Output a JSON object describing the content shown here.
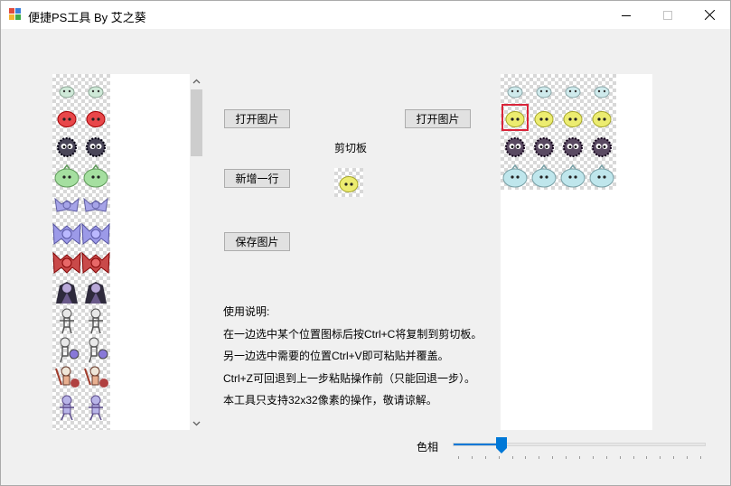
{
  "window": {
    "title": "便捷PS工具 By 艾之葵",
    "controls": {
      "minimize": "minimize",
      "maximize": "maximize",
      "close": "close"
    }
  },
  "left_panel": {
    "sprites": [
      {
        "color": "#cfe9d8",
        "kind": "slime-small"
      },
      {
        "color": "#e8474a",
        "kind": "slime"
      },
      {
        "color": "#4a4658",
        "kind": "fuzz"
      },
      {
        "color": "#a5dfa0",
        "kind": "slime-big"
      },
      {
        "color": "#a6a4e8",
        "kind": "bat-small"
      },
      {
        "color": "#9c9ae8",
        "kind": "bat"
      },
      {
        "color": "#c94a4a",
        "kind": "bat"
      },
      {
        "color": "#2e2a3c",
        "kind": "vampire"
      },
      {
        "color": "#e8e8e8",
        "kind": "skeleton"
      },
      {
        "color": "#e8e8e8",
        "kind": "skeleton-shield"
      },
      {
        "color": "#e8b090",
        "kind": "skeleton-warrior"
      },
      {
        "color": "#b8b4e8",
        "kind": "skeleton-purple"
      },
      {
        "color": "#8a4a3a",
        "kind": "partial"
      }
    ]
  },
  "right_panel": {
    "rows": [
      {
        "color": "#cfeaec",
        "kind": "slime-small"
      },
      {
        "color": "#ecec70",
        "kind": "slime"
      },
      {
        "color": "#5a4a62",
        "kind": "fuzz"
      },
      {
        "color": "#bfe6ec",
        "kind": "slime-big"
      }
    ],
    "selected": {
      "row": 1,
      "col": 0
    }
  },
  "buttons": {
    "open_left": "打开图片",
    "open_right": "打开图片",
    "add_row": "新增一行",
    "save_image": "保存图片"
  },
  "clipboard": {
    "label": "剪切板",
    "sprite_color": "#ecec70"
  },
  "instructions": {
    "title": "使用说明:",
    "lines": [
      "在一边选中某个位置图标后按Ctrl+C将复制到剪切板。",
      "另一边选中需要的位置Ctrl+V即可粘贴并覆盖。",
      "Ctrl+Z可回退到上一步粘贴操作前（只能回退一步）。",
      "本工具只支持32x32像素的操作，敬请谅解。"
    ]
  },
  "hue": {
    "label": "色相",
    "value": 18,
    "max": 100,
    "ticks": 19
  },
  "colors": {
    "accent": "#0078d7",
    "selection": "#d9253a"
  }
}
